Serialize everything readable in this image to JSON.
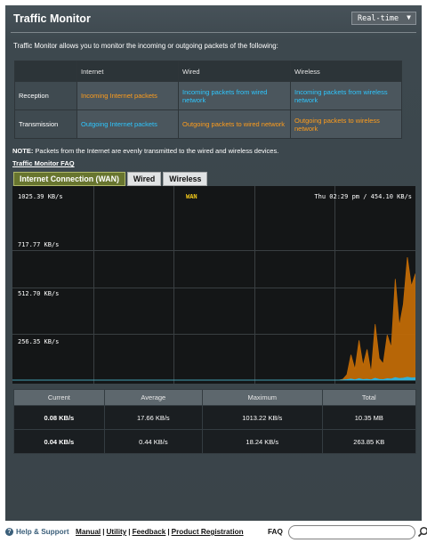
{
  "header": {
    "title": "Traffic Monitor",
    "mode_select": "Real-time"
  },
  "description": "Traffic Monitor allows you to monitor the incoming or outgoing packets of the following:",
  "packets_table": {
    "columns": [
      "Internet",
      "Wired",
      "Wireless"
    ],
    "rows": [
      {
        "label": "Reception",
        "cells": [
          "Incoming Internet packets",
          "Incoming packets from wired network",
          "Incoming packets from wireless network"
        ]
      },
      {
        "label": "Transmission",
        "cells": [
          "Outgoing Internet packets",
          "Outgoing packets to wired network",
          "Outgoing packets to wireless network"
        ]
      }
    ]
  },
  "note": {
    "prefix": "NOTE:",
    "text": " Packets from the Internet are evenly transmitted to the wired and wireless devices."
  },
  "faq_link": "Traffic Monitor FAQ",
  "tabs": [
    "Internet Connection (WAN)",
    "Wired",
    "Wireless"
  ],
  "graph": {
    "series_label": "WAN",
    "time_readout": "Thu 02:29 pm / 454.10 KB/s",
    "y_labels": [
      "1025.39 KB/s",
      "717.77 KB/s",
      "512.70 KB/s",
      "256.35 KB/s"
    ],
    "colors": {
      "received": "#c06a06",
      "sent": "#27b7e8",
      "grid": "#3a3f42"
    }
  },
  "chart_data": {
    "type": "area",
    "ylabel": "KB/s",
    "ylim": [
      0,
      1025.39
    ],
    "series": [
      {
        "name": "WAN",
        "color": "#c06a06",
        "values": [
          0,
          0,
          0,
          0,
          0,
          0,
          0,
          0,
          0,
          0,
          0,
          0,
          0,
          0,
          0,
          0,
          0,
          0,
          0,
          0,
          0,
          0,
          0,
          0,
          0,
          0,
          0,
          0,
          0,
          0,
          0,
          0,
          0,
          0,
          0,
          0,
          0,
          0,
          0,
          0,
          0,
          0,
          0,
          0,
          0,
          0,
          0,
          0,
          0,
          0,
          0,
          0,
          0,
          0,
          0,
          0,
          0,
          0,
          0,
          0,
          0,
          0,
          0,
          0,
          0,
          0,
          0,
          0,
          0,
          0,
          0,
          0,
          0,
          0,
          0,
          0,
          0,
          0,
          0,
          0,
          0,
          0,
          5,
          30,
          140,
          60,
          220,
          80,
          170,
          40,
          310,
          120,
          90,
          250,
          180,
          560,
          300,
          420,
          680,
          520,
          590
        ]
      },
      {
        "color": "#27b7e8",
        "values": [
          0,
          0,
          0,
          0,
          0,
          0,
          0,
          0,
          0,
          0,
          0,
          0,
          0,
          0,
          0,
          0,
          0,
          0,
          0,
          0,
          0,
          0,
          0,
          0,
          0,
          0,
          0,
          0,
          0,
          0,
          0,
          0,
          0,
          0,
          0,
          0,
          0,
          0,
          0,
          0,
          0,
          0,
          0,
          0,
          0,
          0,
          0,
          0,
          0,
          0,
          0,
          0,
          0,
          0,
          0,
          0,
          0,
          0,
          0,
          0,
          0,
          0,
          0,
          0,
          0,
          0,
          0,
          0,
          0,
          0,
          0,
          0,
          0,
          0,
          0,
          0,
          0,
          0,
          0,
          0,
          0,
          0,
          1,
          3,
          6,
          2,
          8,
          3,
          5,
          2,
          10,
          4,
          3,
          8,
          6,
          14,
          9,
          11,
          16,
          12,
          13
        ]
      }
    ]
  },
  "stats": {
    "headers": [
      "Current",
      "Average",
      "Maximum",
      "Total"
    ],
    "received": [
      "0.08 KB/s",
      "17.66 KB/s",
      "1013.22 KB/s",
      "10.35 MB"
    ],
    "sent": [
      "0.04 KB/s",
      "0.44 KB/s",
      "18.24 KB/s",
      "263.85 KB"
    ]
  },
  "footer": {
    "help": "Help & Support",
    "links": [
      "Manual",
      "Utility",
      "Feedback",
      "Product Registration"
    ],
    "faq": "FAQ",
    "search_placeholder": ""
  }
}
